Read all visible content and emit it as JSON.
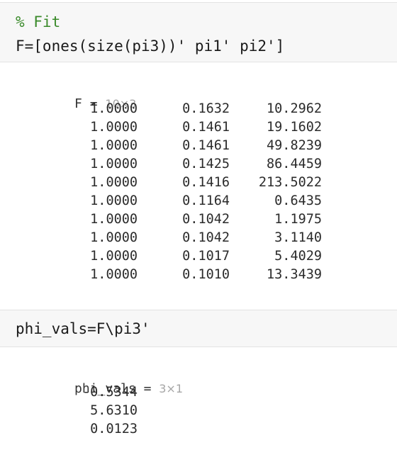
{
  "cell1": {
    "comment": "% Fit",
    "code": "F=[ones(size(pi3))' pi1' pi2']"
  },
  "output1": {
    "var_name": "F",
    "equals": " = ",
    "dims": "10×3",
    "rows": [
      [
        "1.0000",
        "0.1632",
        "10.2962"
      ],
      [
        "1.0000",
        "0.1461",
        "19.1602"
      ],
      [
        "1.0000",
        "0.1461",
        "49.8239"
      ],
      [
        "1.0000",
        "0.1425",
        "86.4459"
      ],
      [
        "1.0000",
        "0.1416",
        "213.5022"
      ],
      [
        "1.0000",
        "0.1164",
        "0.6435"
      ],
      [
        "1.0000",
        "0.1042",
        "1.1975"
      ],
      [
        "1.0000",
        "0.1042",
        "3.1140"
      ],
      [
        "1.0000",
        "0.1017",
        "5.4029"
      ],
      [
        "1.0000",
        "0.1010",
        "13.3439"
      ]
    ]
  },
  "cell2": {
    "code": "phi_vals=F\\pi3'"
  },
  "output2": {
    "var_name": "phi_vals",
    "equals": " = ",
    "dims": "3×1",
    "values": [
      "-0.5344",
      "5.6310",
      "0.0123"
    ]
  }
}
